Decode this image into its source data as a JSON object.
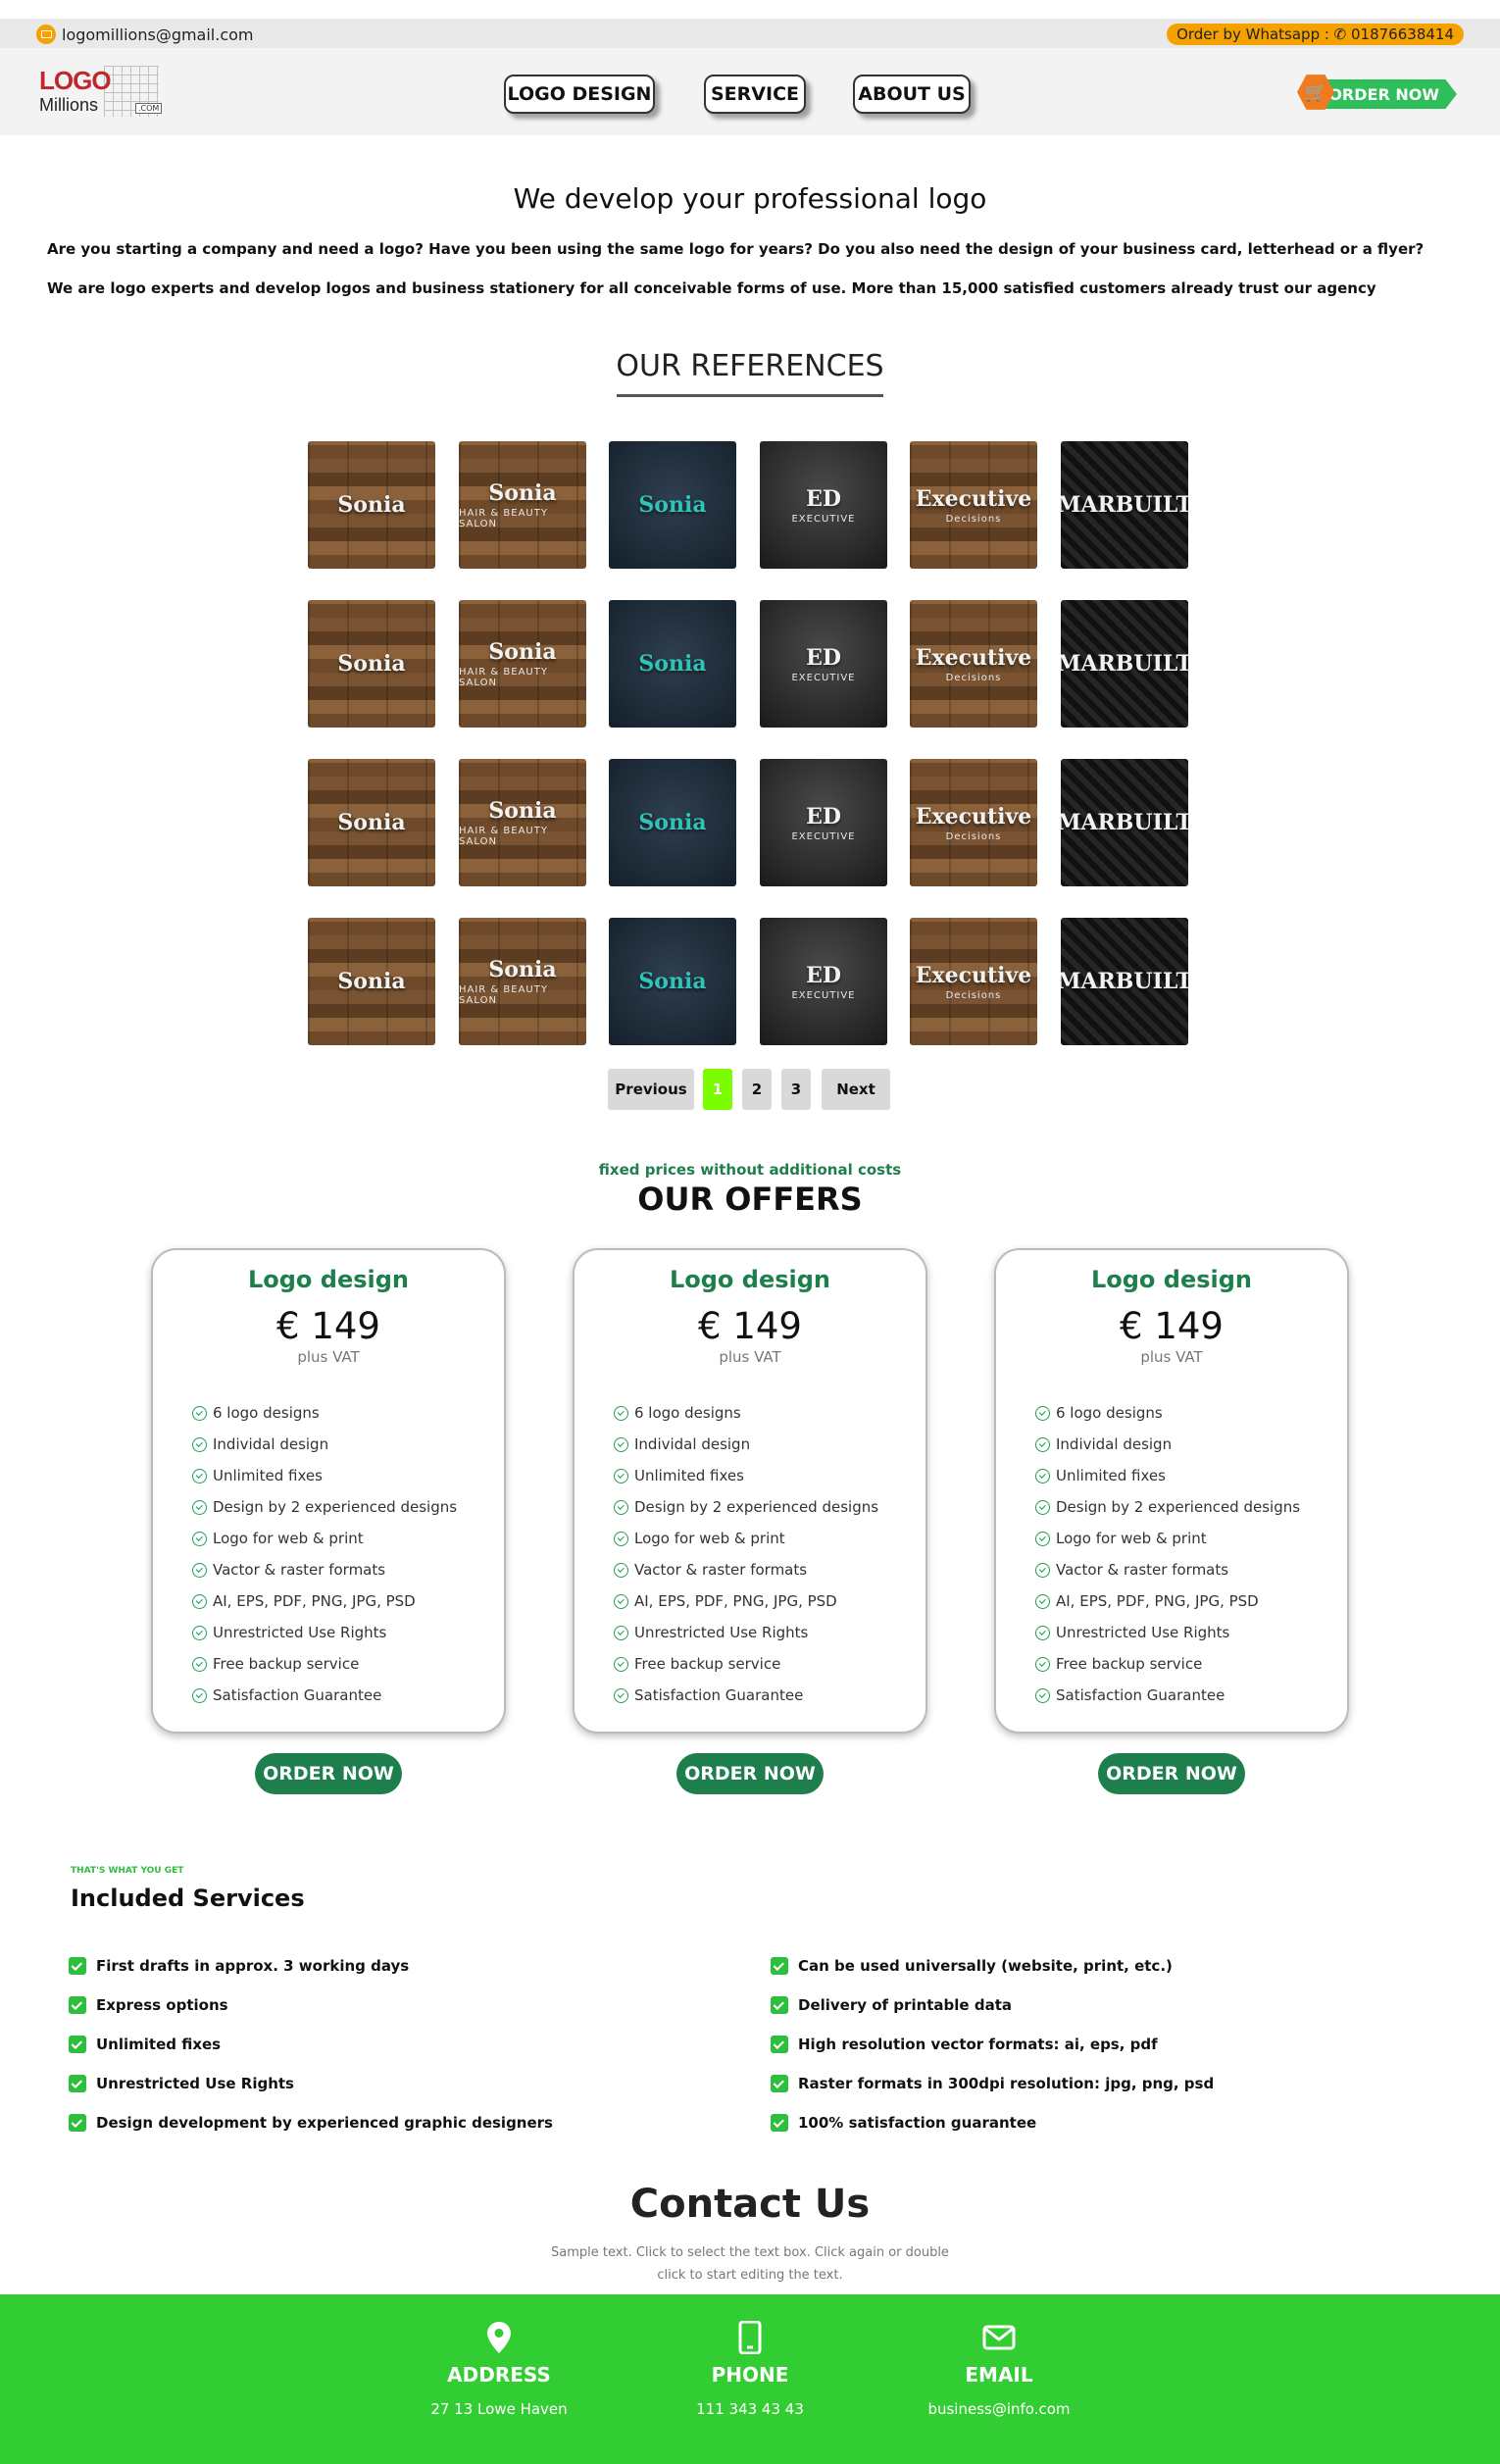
{
  "topbar": {
    "email": "logomillions@gmail.com",
    "whatsapp": "Order by Whatsapp : ✆ 01876638414"
  },
  "header": {
    "logo_word": "LOGO",
    "logo_sub": "Millions",
    "logo_com": ".COM",
    "nav": [
      "LOGO DESIGN",
      "SERVICE",
      "ABOUT US"
    ],
    "order_now": "ORDER NOW"
  },
  "intro": {
    "title": "We develop your professional logo",
    "p1": "Are you starting a company and need a logo? Have you been using the same logo for years? Do you also need the design of your business card, letterhead or a flyer?",
    "p2": "We are logo experts and develop logos and business stationery for all conceivable forms of use. More than 15,000 satisfied customers already trust our agency"
  },
  "references": {
    "title": "OUR REFERENCES",
    "columns": [
      {
        "style": "wood",
        "mark": "Sonia",
        "sub": ""
      },
      {
        "style": "wood",
        "mark": "Sonia",
        "sub": "HAIR & BEAUTY SALON"
      },
      {
        "style": "navy",
        "mark": "Sonia",
        "sub": ""
      },
      {
        "style": "dark",
        "mark": "ED",
        "sub": "EXECUTIVE"
      },
      {
        "style": "wood",
        "mark": "Executive",
        "sub": "Decisions"
      },
      {
        "style": "black",
        "mark": "MARBUILT",
        "sub": ""
      }
    ],
    "rows": 4
  },
  "pagination": [
    "Previous",
    "1",
    "2",
    "3",
    "Next"
  ],
  "offers": {
    "kicker": "fixed prices without additional costs",
    "title": "OUR OFFERS",
    "cards": [
      {
        "title": "Logo design",
        "price": "€ 149",
        "vat": "plus VAT",
        "button": "ORDER NOW"
      },
      {
        "title": "Logo design",
        "price": "€ 149",
        "vat": "plus VAT",
        "button": "ORDER NOW"
      },
      {
        "title": "Logo design",
        "price": "€ 149",
        "vat": "plus VAT",
        "button": "ORDER NOW"
      }
    ],
    "features": [
      "6 logo designs",
      "Individal design",
      "Unlimited fixes",
      "Design by 2 experienced designs",
      "Logo for web & print",
      "Vactor & raster formats",
      "AI, EPS, PDF, PNG, JPG, PSD",
      "Unrestricted Use Rights",
      "Free backup service",
      "Satisfaction Guarantee"
    ]
  },
  "services": {
    "kicker": "THAT'S WHAT YOU GET",
    "title": "Included Services",
    "left": [
      "First drafts in approx. 3 working days",
      "Express options",
      "Unlimited fixes",
      "Unrestricted Use Rights",
      "Design development by experienced graphic designers"
    ],
    "right": [
      "Can be used universally (website, print, etc.)",
      "Delivery of printable data",
      "High resolution vector formats: ai, eps, pdf",
      "Raster formats in 300dpi resolution: jpg, png, psd",
      "100% satisfaction guarantee"
    ]
  },
  "contact": {
    "title": "Contact Us",
    "sub": "Sample text. Click to select the text box. Click again or double click to start editing the text.",
    "address_label": "ADDRESS",
    "address": "27 13 Lowe Haven",
    "phone_label": "PHONE",
    "phone": "111 343 43 43",
    "email_label": "EMAIL",
    "email": "business@info.com"
  },
  "colors": {
    "accent_green": "#1e7f4d",
    "footer_green": "#32cd32",
    "whatsapp_orange": "#f5a100",
    "pager_active": "#7cfc00"
  }
}
